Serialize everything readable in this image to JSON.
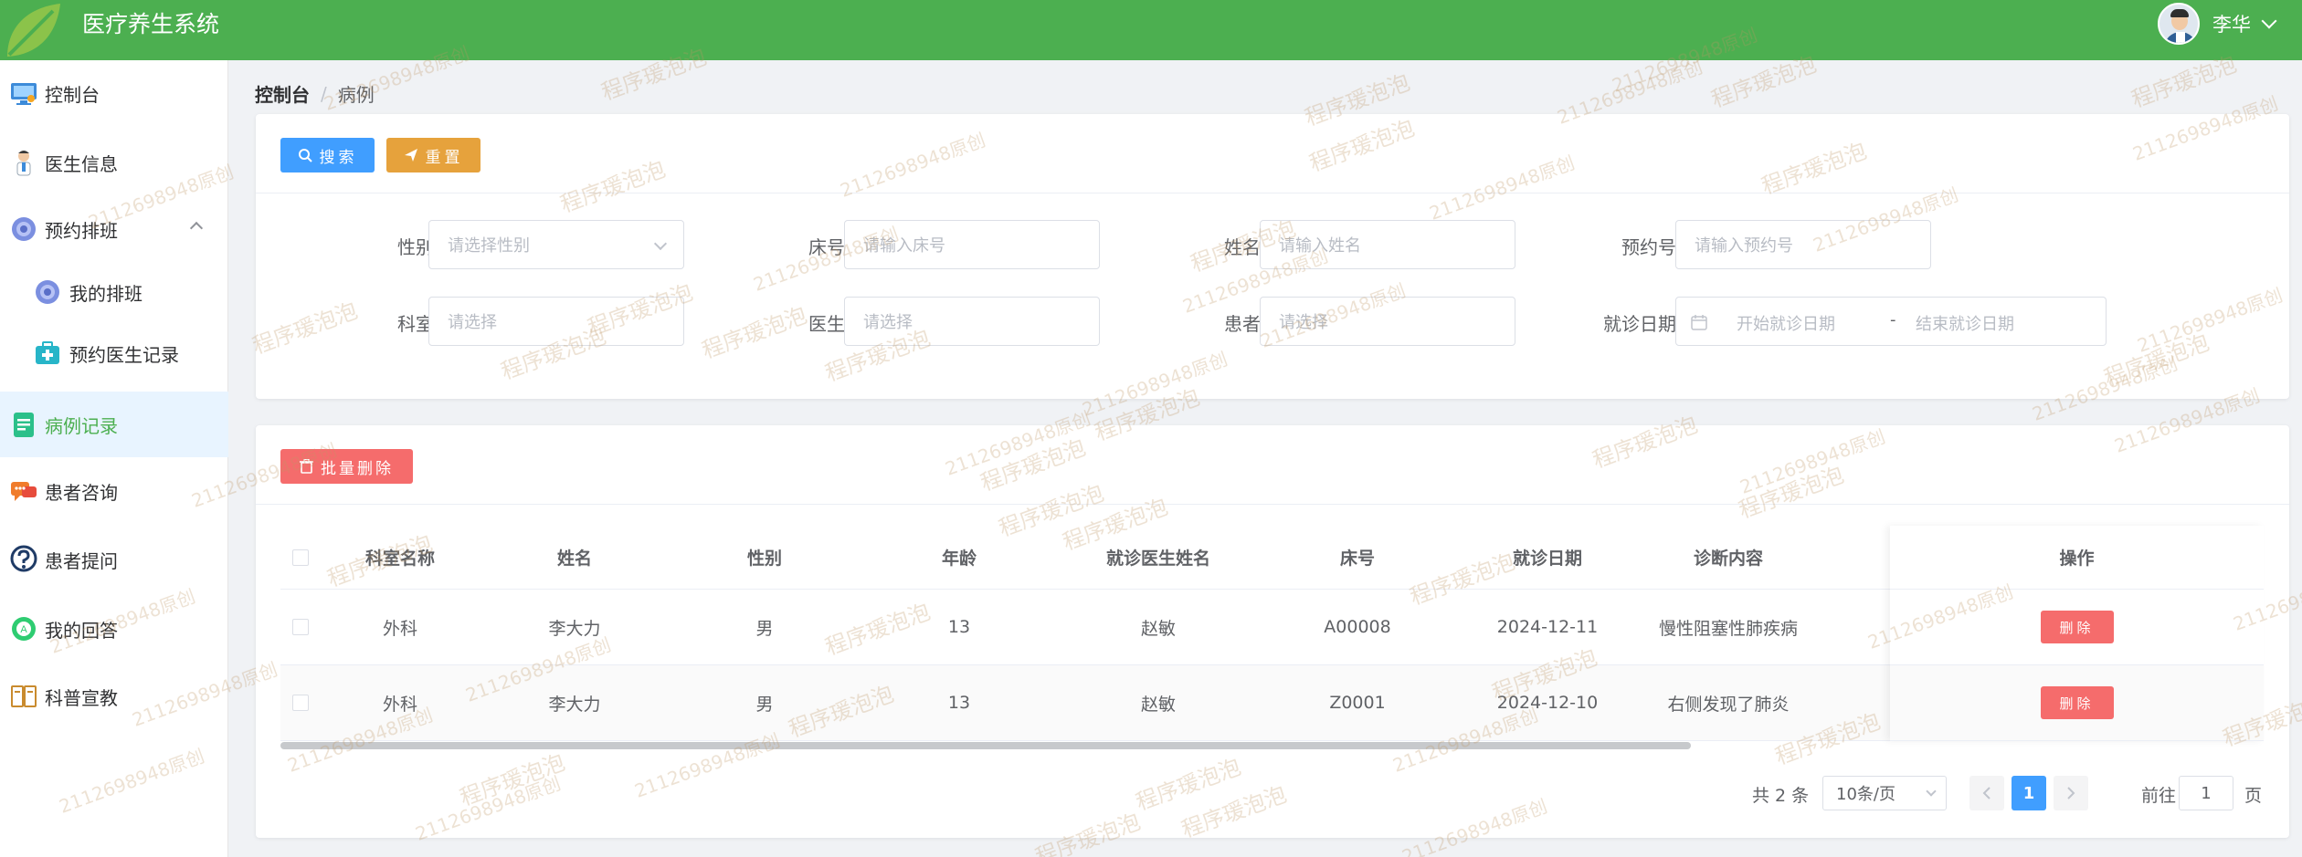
{
  "header": {
    "app_title": "医疗养生系统",
    "user_name": "李华"
  },
  "sidebar": {
    "items": [
      {
        "label": "控制台",
        "icon": "monitor-icon"
      },
      {
        "label": "医生信息",
        "icon": "doctor-icon"
      },
      {
        "label": "预约排班",
        "icon": "gear-flower-icon"
      },
      {
        "label": "我的排班",
        "icon": "gear-flower-icon"
      },
      {
        "label": "预约医生记录",
        "icon": "medical-kit-icon"
      },
      {
        "label": "病例记录",
        "icon": "document-icon"
      },
      {
        "label": "患者咨询",
        "icon": "chat-icon"
      },
      {
        "label": "患者提问",
        "icon": "question-icon"
      },
      {
        "label": "我的回答",
        "icon": "answer-icon"
      },
      {
        "label": "科普宣教",
        "icon": "book-icon"
      }
    ],
    "active": "病例记录"
  },
  "breadcrumb": {
    "home": "控制台",
    "separator": "/",
    "current": "病例"
  },
  "search": {
    "search_label": "搜索",
    "reset_label": "重置",
    "gender_label": "性别",
    "gender_placeholder": "请选择性别",
    "bed_label": "床号",
    "bed_placeholder": "请输入床号",
    "name_label": "姓名",
    "name_placeholder": "请输入姓名",
    "appt_label": "预约号",
    "appt_placeholder": "请输入预约号",
    "dept_label": "科室",
    "dept_placeholder": "请选择",
    "doctor_label": "医生",
    "doctor_placeholder": "请选择",
    "patient_label": "患者",
    "patient_placeholder": "请选择",
    "date_label": "就诊日期",
    "date_start_placeholder": "开始就诊日期",
    "date_sep": "-",
    "date_end_placeholder": "结束就诊日期"
  },
  "table": {
    "batch_delete_label": "批量删除",
    "columns": [
      "科室名称",
      "姓名",
      "性别",
      "年龄",
      "就诊医生姓名",
      "床号",
      "就诊日期",
      "诊断内容",
      "操作"
    ],
    "rows": [
      {
        "dept": "外科",
        "name": "李大力",
        "gender": "男",
        "age": "13",
        "doctor": "赵敏",
        "bed": "A00008",
        "date": "2024-12-11",
        "diagnosis": "慢性阻塞性肺疾病",
        "action": "删除"
      },
      {
        "dept": "外科",
        "name": "李大力",
        "gender": "男",
        "age": "13",
        "doctor": "赵敏",
        "bed": "Z0001",
        "date": "2024-12-10",
        "diagnosis": "右侧发现了肺炎",
        "action": "删除"
      }
    ]
  },
  "pagination": {
    "total_text": "共 2 条",
    "page_size": "10条/页",
    "current_page": "1",
    "goto_label": "前往",
    "goto_value": "1",
    "page_unit": "页"
  },
  "watermark": {
    "name": "程序瑗泡泡",
    "id": "2112698948原创"
  },
  "colors": {
    "header_green": "#4caf50",
    "primary_blue": "#409eff",
    "warning_orange": "#e6a23c",
    "danger_red": "#f56c6c"
  }
}
